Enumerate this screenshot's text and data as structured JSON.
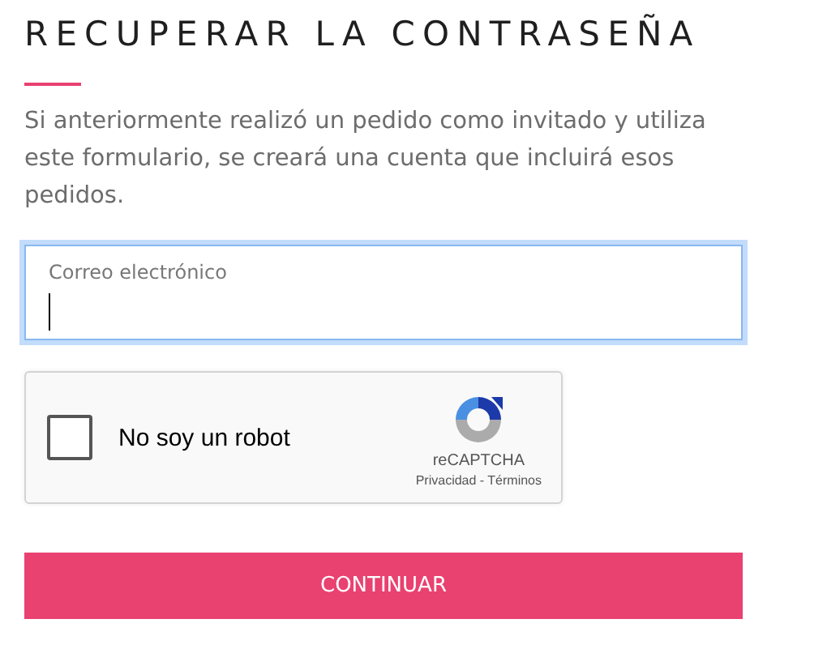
{
  "title": "RECUPERAR LA CONTRASEÑA",
  "description": "Si anteriormente realizó un pedido como invitado y utiliza este formulario, se creará una cuenta que incluirá esos pedidos.",
  "email_field": {
    "label": "Correo electrónico",
    "focused": true
  },
  "captcha": {
    "label": "No soy un robot",
    "checked": false,
    "brand": "reCAPTCHA",
    "links": "Privacidad - Términos"
  },
  "submit_button": "CONTINUAR"
}
